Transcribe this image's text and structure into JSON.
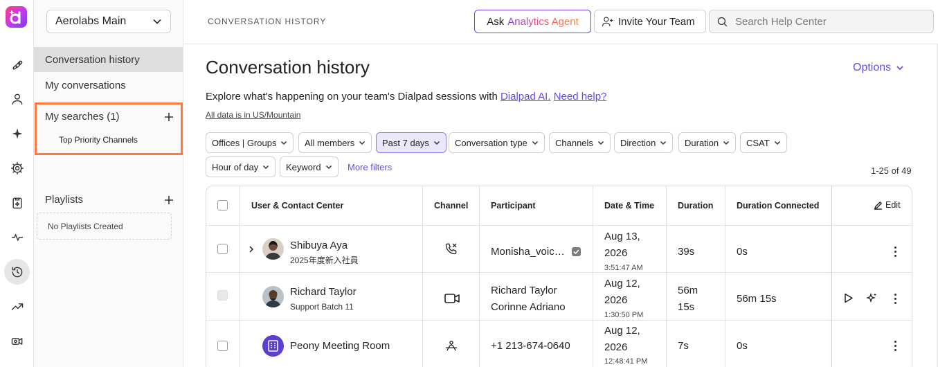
{
  "workspace": {
    "name": "Aerolabs Main"
  },
  "sidebar": {
    "items": [
      {
        "label": "Conversation history"
      },
      {
        "label": "My conversations"
      }
    ],
    "searches": {
      "title": "My searches (1)",
      "entries": [
        "Top Priority Channels"
      ]
    },
    "playlists": {
      "title": "Playlists",
      "empty": "No Playlists Created"
    }
  },
  "topbar": {
    "breadcrumb": "CONVERSATION HISTORY",
    "ask": {
      "prefix": "Ask",
      "agent": "Analytics Agent"
    },
    "invite": "Invite Your Team",
    "search_placeholder": "Search Help Center"
  },
  "page": {
    "title": "Conversation history",
    "options": "Options",
    "intro": "Explore what's happening on your team's Dialpad sessions with",
    "intro_link1": "Dialpad AI.",
    "intro_link2": "Need help?",
    "timezone": "All data is in US/Mountain"
  },
  "filters": [
    "Offices | Groups",
    "All members",
    "Past 7 days",
    "Conversation type",
    "Channels",
    "Direction",
    "Duration",
    "CSAT",
    "Hour of day",
    "Keyword"
  ],
  "more_filters": "More filters",
  "result_count": "1-25 of 49",
  "table": {
    "headers": [
      "User & Contact Center",
      "Channel",
      "Participant",
      "Date & Time",
      "Duration",
      "Duration Connected"
    ],
    "edit_label": "Edit",
    "rows": [
      {
        "name": "Shibuya Aya",
        "sub": "2025年度新入社員",
        "participant": [
          "Monisha_voic…"
        ],
        "date": "Aug 13,",
        "year": "2026",
        "time": "3:51:47 AM",
        "duration": [
          "39s"
        ],
        "connected": "0s",
        "channel_icon": "missed-call-icon"
      },
      {
        "name": "Richard Taylor",
        "sub": "Support Batch 11",
        "participant": [
          "Richard Taylor",
          "Corinne Adriano"
        ],
        "date": "Aug 12,",
        "year": "2026",
        "time": "1:30:50 PM",
        "duration": [
          "56m",
          "15s"
        ],
        "connected": "56m 15s",
        "channel_icon": "video-icon"
      },
      {
        "name": "Peony Meeting Room",
        "sub": "",
        "participant": [
          "+1 213-674-0640"
        ],
        "date": "Aug 12,",
        "year": "2026",
        "time": "12:48:41 PM",
        "duration": [
          "7s"
        ],
        "connected": "0s",
        "channel_icon": "meeting-room-icon"
      }
    ]
  },
  "colors": {
    "accent": "#6b47ea",
    "highlight": "#ff7a3c"
  }
}
